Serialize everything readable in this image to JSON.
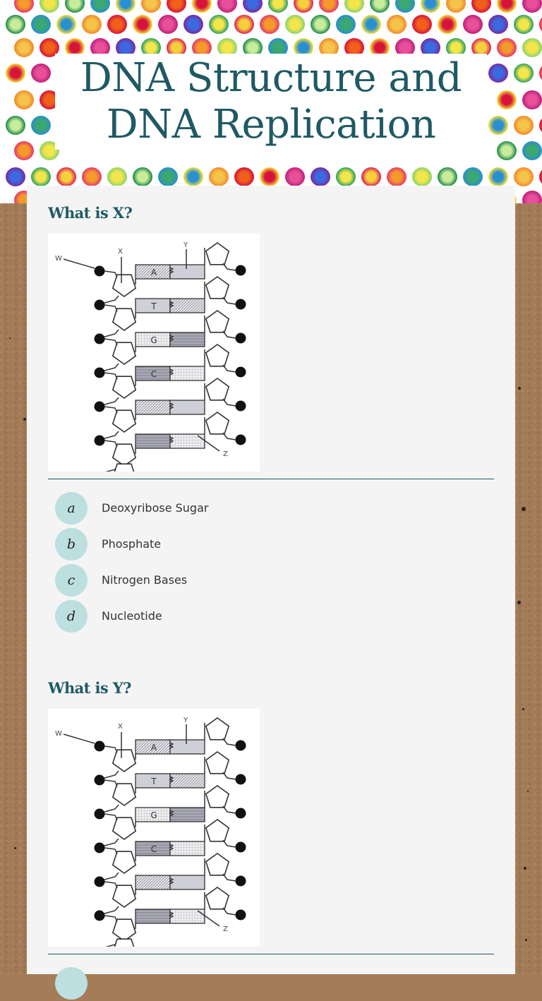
{
  "page": {
    "title_line1": "DNA Structure and",
    "title_line2": "DNA Replication"
  },
  "theme": {
    "title_color": "#1f5a64",
    "option_circle_color": "#bcdfe0",
    "sheet_color": "#f4f4f4",
    "background_color": "#a37b56"
  },
  "questions": [
    {
      "title": "What is X?",
      "image": {
        "name": "dna-structure-diagram",
        "labels": [
          "W",
          "X",
          "Y",
          "Z"
        ],
        "base_pairs": [
          {
            "left": "A",
            "right": ""
          },
          {
            "left": "T",
            "right": ""
          },
          {
            "left": "G",
            "right": ""
          },
          {
            "left": "C",
            "right": ""
          },
          {
            "left": "",
            "right": ""
          },
          {
            "left": "",
            "right": ""
          }
        ]
      },
      "options": [
        {
          "letter": "a",
          "text": "Deoxyribose Sugar"
        },
        {
          "letter": "b",
          "text": "Phosphate"
        },
        {
          "letter": "c",
          "text": "Nitrogen Bases"
        },
        {
          "letter": "d",
          "text": "Nucleotide"
        }
      ]
    },
    {
      "title": "What is Y?",
      "image": {
        "name": "dna-structure-diagram",
        "labels": [
          "W",
          "X",
          "Y",
          "Z"
        ],
        "base_pairs": [
          {
            "left": "A",
            "right": ""
          },
          {
            "left": "T",
            "right": ""
          },
          {
            "left": "G",
            "right": ""
          },
          {
            "left": "C",
            "right": ""
          },
          {
            "left": "",
            "right": ""
          },
          {
            "left": "",
            "right": ""
          }
        ]
      },
      "options": [
        {
          "letter": "",
          "text": ""
        }
      ]
    }
  ]
}
